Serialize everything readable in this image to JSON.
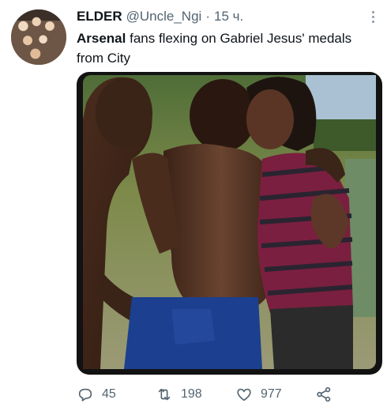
{
  "tweet": {
    "author_name": "ELDER",
    "author_handle": "@Uncle_Ngi",
    "separator": "·",
    "time": "15 ч.",
    "text_bold": "Arsenal",
    "text_rest": " fans flexing on Gabriel Jesus' medals from City"
  },
  "actions": {
    "reply_count": "45",
    "retweet_count": "198",
    "like_count": "977"
  },
  "icons": {
    "more": "more-icon",
    "reply": "reply-icon",
    "retweet": "retweet-icon",
    "like": "like-icon",
    "share": "share-icon"
  },
  "colors": {
    "text": "#0f1419",
    "secondary": "#536471"
  }
}
